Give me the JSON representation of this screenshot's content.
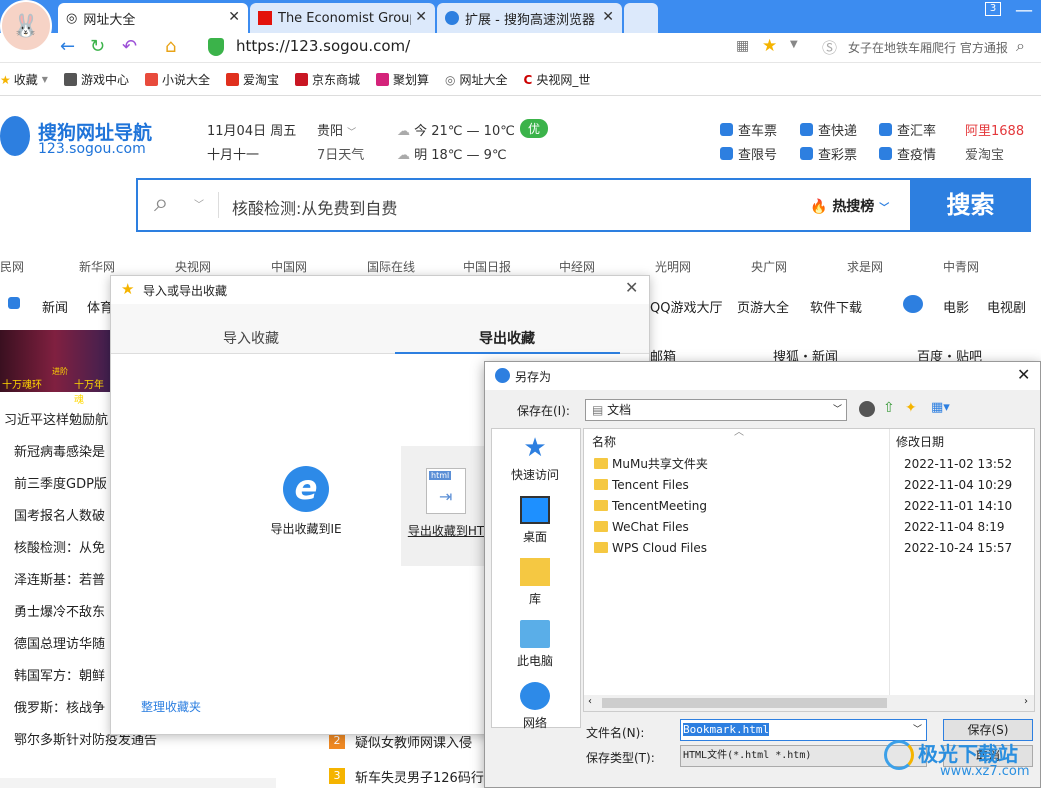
{
  "browser": {
    "tabs": [
      {
        "title": "网址大全"
      },
      {
        "title": "The Economist Group"
      },
      {
        "title": "扩展 - 搜狗高速浏览器"
      }
    ],
    "tab_count": "3",
    "url": "https://123.sogou.com/",
    "news_ticker": "女子在地铁车厢爬行 官方通报",
    "bookmarks": [
      "收藏",
      "游戏中心",
      "小说大全",
      "爱淘宝",
      "京东商城",
      "聚划算",
      "网址大全",
      "央视网_世"
    ]
  },
  "page": {
    "logo_title": "搜狗网址导航",
    "logo_url": "123.sogou.com",
    "date": "11月04日 周五",
    "lunar": "十月十一",
    "city": "贵阳",
    "weather_link": "7日天气",
    "today": "今 21℃ — 10℃",
    "aqi": "优",
    "tomorrow": "明 18℃ — 9℃",
    "services": [
      "查车票",
      "查快递",
      "查汇率",
      "查限号",
      "查彩票",
      "查疫情"
    ],
    "ads": [
      "阿里1688",
      "爱淘宝"
    ],
    "search_placeholder": "核酸检测:从免费到自费",
    "hot_label": "热搜榜",
    "search_button": "搜索",
    "nav_sites": [
      "新华网",
      "央视网",
      "中国网",
      "国际在线",
      "中国日报",
      "中经网",
      "光明网",
      "央广网",
      "求是网",
      "中青网"
    ],
    "nav_sites_cut": "民网",
    "cat_row": [
      "新闻",
      "体育",
      "QQ游戏大厅",
      "页游大全",
      "软件下载",
      "电影",
      "电视剧"
    ],
    "news": [
      "习近平这样勉励航",
      "新冠病毒感染是",
      "前三季度GDP版",
      "国考报名人数破",
      "核酸检测：从免",
      "泽连斯基：若普",
      "勇士爆冷不敌东",
      "德国总理访华随",
      "韩国军方：朝鲜",
      "俄罗斯：核战争",
      "鄂尔多斯针对防疫发通告"
    ],
    "banner_left": "十万魂环",
    "banner_mid": "进阶",
    "banner_right": "十万年魂",
    "hot_items": [
      "疑似女教师网课入侵",
      "斩车失灵男子126码行"
    ],
    "links_right": [
      "邮箱",
      "搜狐・新闻",
      "百度・贴吧"
    ]
  },
  "export_dialog": {
    "title": "导入或导出收藏",
    "tab_import": "导入收藏",
    "tab_export": "导出收藏",
    "to_ie": "导出收藏到IE",
    "to_html": "导出收藏到HT",
    "html_badge": "html",
    "manage": "整理收藏夹"
  },
  "save_dialog": {
    "title": "另存为",
    "save_in_label": "保存在(I):",
    "location": "文档",
    "col_name": "名称",
    "col_date": "修改日期",
    "quick_access": [
      "快速访问",
      "桌面",
      "库",
      "此电脑",
      "网络"
    ],
    "files": [
      {
        "name": "MuMu共享文件夹",
        "date": "2022-11-02 13:52"
      },
      {
        "name": "Tencent Files",
        "date": "2022-11-04 10:29"
      },
      {
        "name": "TencentMeeting",
        "date": "2022-11-01 14:10"
      },
      {
        "name": "WeChat Files",
        "date": "2022-11-04 8:19"
      },
      {
        "name": "WPS Cloud Files",
        "date": "2022-10-24 15:57"
      }
    ],
    "filename_label": "文件名(N):",
    "filename": "Bookmark.html",
    "filetype_label": "保存类型(T):",
    "filetype": "HTML文件(*.html *.htm)",
    "save_button": "保存(S)",
    "cancel_button": "取消"
  },
  "watermark": {
    "text": "极光下载站",
    "url": "www.xz7.com"
  },
  "colors": {
    "accent": "#2d7fe0",
    "tabbar": "#3c8cf0",
    "aqi": "#3bb34a"
  }
}
